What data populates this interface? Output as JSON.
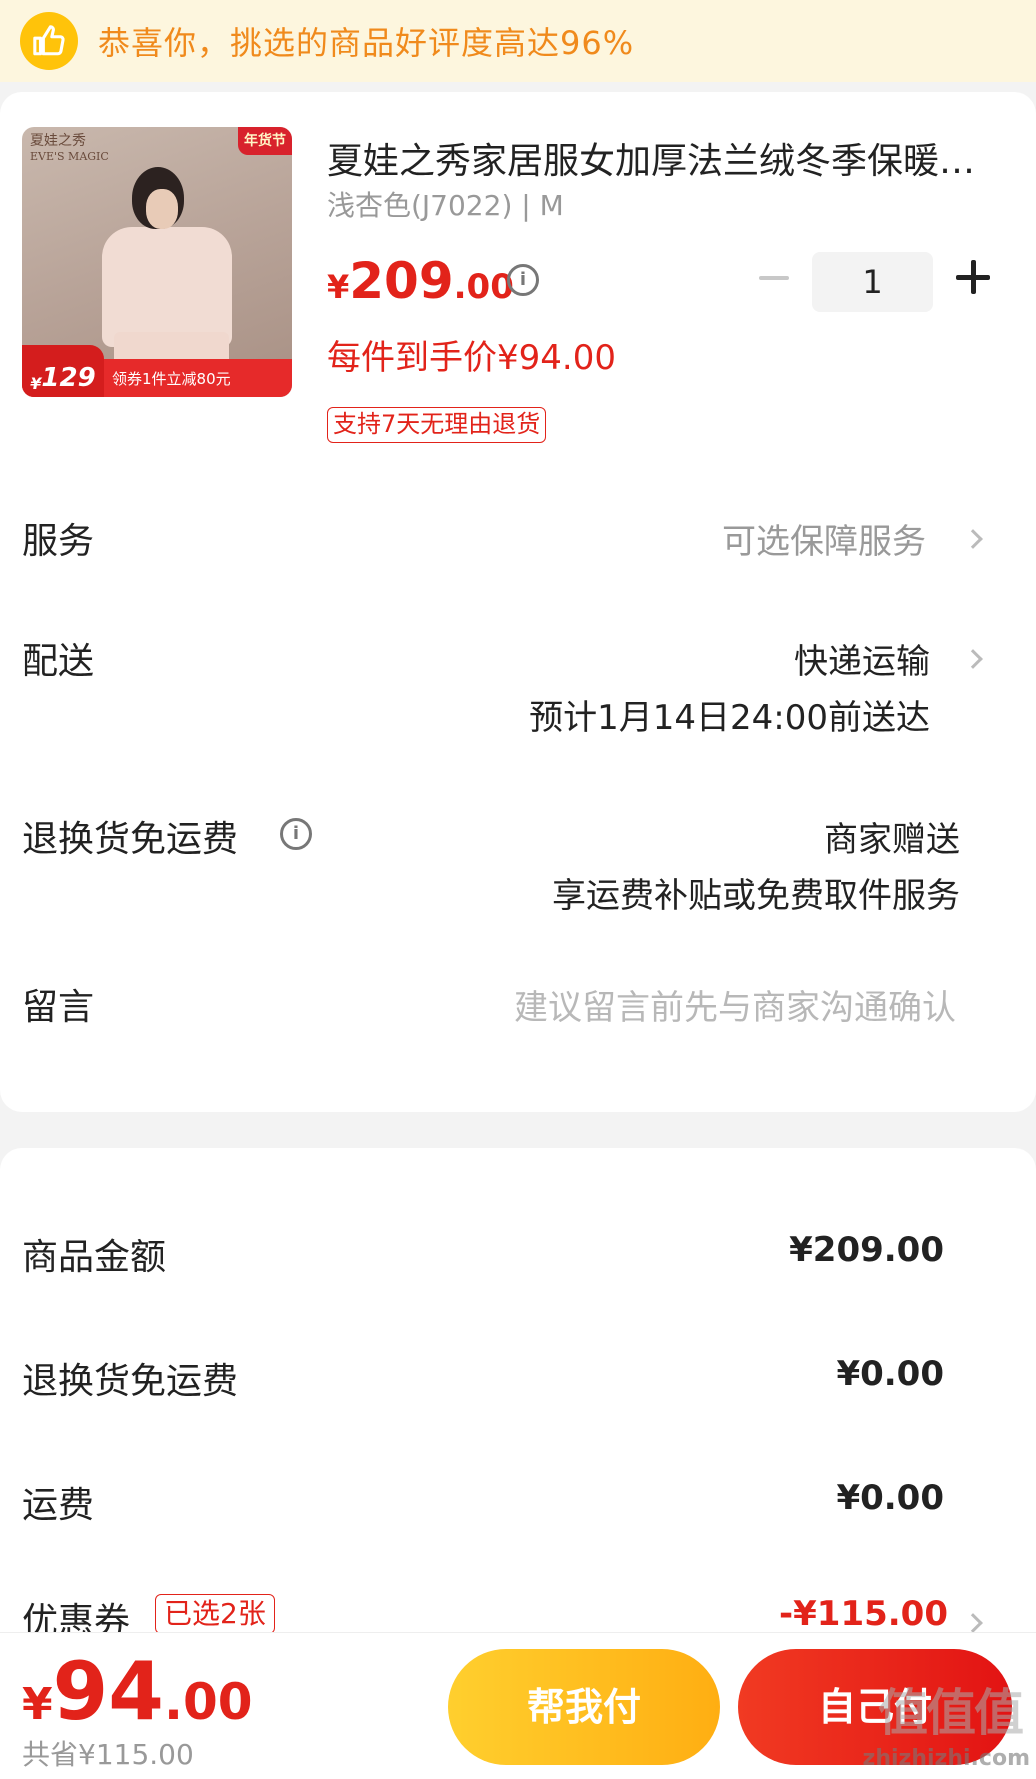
{
  "banner": {
    "icon": "thumbs-up-icon",
    "text": "恭喜你，挑选的商品好评度高达96%"
  },
  "product": {
    "image": {
      "brand_mark_line1": "夏娃之秀",
      "brand_mark_line2": "EVE'S MAGIC",
      "corner_tag": "年货节",
      "promo_price": "129",
      "promo_text": "领券1件立减80元"
    },
    "title": "夏娃之秀家居服女加厚法兰绒冬季保暖套装",
    "spec": "浅杏色(J7022) | M",
    "price": {
      "currency": "¥",
      "integer": "209",
      "decimal": ".00"
    },
    "per_item_price": "每件到手价¥94.00",
    "return_policy": "支持7天无理由退货",
    "quantity": "1"
  },
  "rows": {
    "service": {
      "label": "服务",
      "value": "可选保障服务"
    },
    "delivery": {
      "label": "配送",
      "value": "快递运输",
      "eta": "预计1月14日24:00前送达"
    },
    "return_shipping": {
      "label": "退换货免运费",
      "value": "商家赠送",
      "sub": "享运费补贴或免费取件服务"
    },
    "message": {
      "label": "留言",
      "placeholder": "建议留言前先与商家沟通确认"
    }
  },
  "summary": {
    "goods_amount": {
      "label": "商品金额",
      "value": "¥209.00"
    },
    "return_fee": {
      "label": "退换货免运费",
      "value": "¥0.00"
    },
    "shipping": {
      "label": "运费",
      "value": "¥0.00"
    },
    "coupon": {
      "label": "优惠券",
      "tag": "已选2张",
      "value": "-¥115.00"
    }
  },
  "footer": {
    "total": {
      "currency": "¥",
      "integer": "94",
      "decimal": ".00"
    },
    "saved": "共省¥115.00",
    "help_pay": "帮我付",
    "self_pay": "自己付",
    "watermark": "zhizhizhi.com",
    "watermark_logo": "值值值"
  },
  "colors": {
    "accent": "#e2231a",
    "banner_text": "#f08a1c",
    "help_pay": "#ffbe1e",
    "self_pay": "#e8261a"
  }
}
